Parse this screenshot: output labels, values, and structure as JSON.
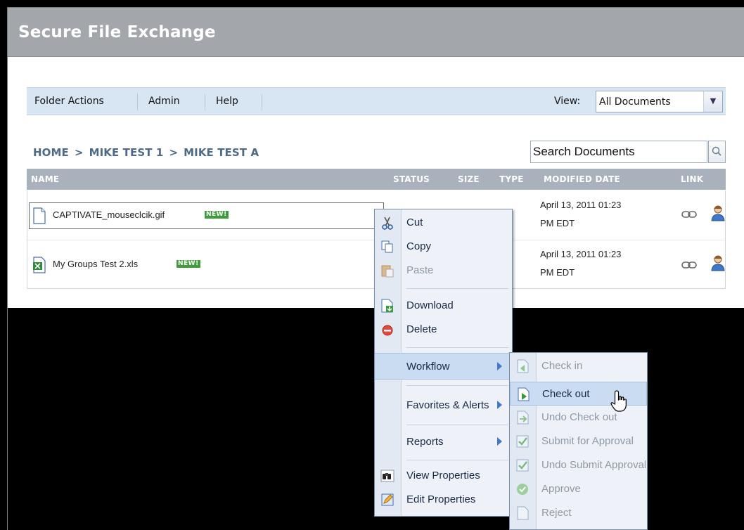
{
  "app": {
    "title": "Secure File Exchange"
  },
  "toolbar": {
    "items": [
      "Folder Actions",
      "Admin",
      "Help"
    ],
    "view_label": "View:",
    "view_value": "All Documents"
  },
  "breadcrumb": {
    "items": [
      "HOME",
      "MIKE TEST 1",
      "MIKE TEST A"
    ],
    "separator": ">"
  },
  "search": {
    "value": "Search Documents"
  },
  "table": {
    "columns": [
      "NAME",
      "STATUS",
      "SIZE",
      "TYPE",
      "MODIFIED DATE",
      "LINK"
    ],
    "rows": [
      {
        "name": "CAPTIVATE_mouseclcik.gif",
        "badge": "NEW!",
        "date_line1": "April 13, 2011 01:23",
        "date_line2": "PM EDT",
        "file_icon": "document-icon"
      },
      {
        "name": "My Groups Test 2.xls",
        "badge": "NEW!",
        "date_line1": "April 13, 2011 01:23",
        "date_line2": "PM EDT",
        "file_icon": "excel-icon"
      }
    ]
  },
  "context_menu": {
    "items": [
      {
        "label": "Cut",
        "icon": "cut-icon",
        "enabled": true
      },
      {
        "label": "Copy",
        "icon": "copy-icon",
        "enabled": true
      },
      {
        "label": "Paste",
        "icon": "paste-icon",
        "enabled": false
      },
      {
        "label": "Download",
        "icon": "download-icon",
        "enabled": true
      },
      {
        "label": "Delete",
        "icon": "delete-icon",
        "enabled": true
      },
      {
        "label": "Workflow",
        "submenu": true,
        "highlighted": true
      },
      {
        "label": "Favorites & Alerts",
        "submenu": true
      },
      {
        "label": "Reports",
        "submenu": true
      },
      {
        "label": "View Properties",
        "icon": "binoculars-icon",
        "enabled": true
      },
      {
        "label": "Edit Properties",
        "icon": "edit-icon",
        "enabled": true
      }
    ]
  },
  "workflow_submenu": {
    "items": [
      {
        "label": "Check in",
        "enabled": false
      },
      {
        "label": "Check out",
        "enabled": true,
        "highlighted": true
      },
      {
        "label": "Undo Check out",
        "enabled": false
      },
      {
        "label": "Submit for Approval",
        "enabled": false
      },
      {
        "label": "Undo Submit Approval",
        "enabled": false
      },
      {
        "label": "Approve",
        "enabled": false
      },
      {
        "label": "Reject",
        "enabled": false
      }
    ]
  },
  "colors": {
    "title_bar": "#a3a6ab",
    "toolbar": "#d8e5f3",
    "table_header": "#a9b2bc",
    "badge": "#3f9b3c",
    "menu_highlight": "#c9dcf2"
  }
}
